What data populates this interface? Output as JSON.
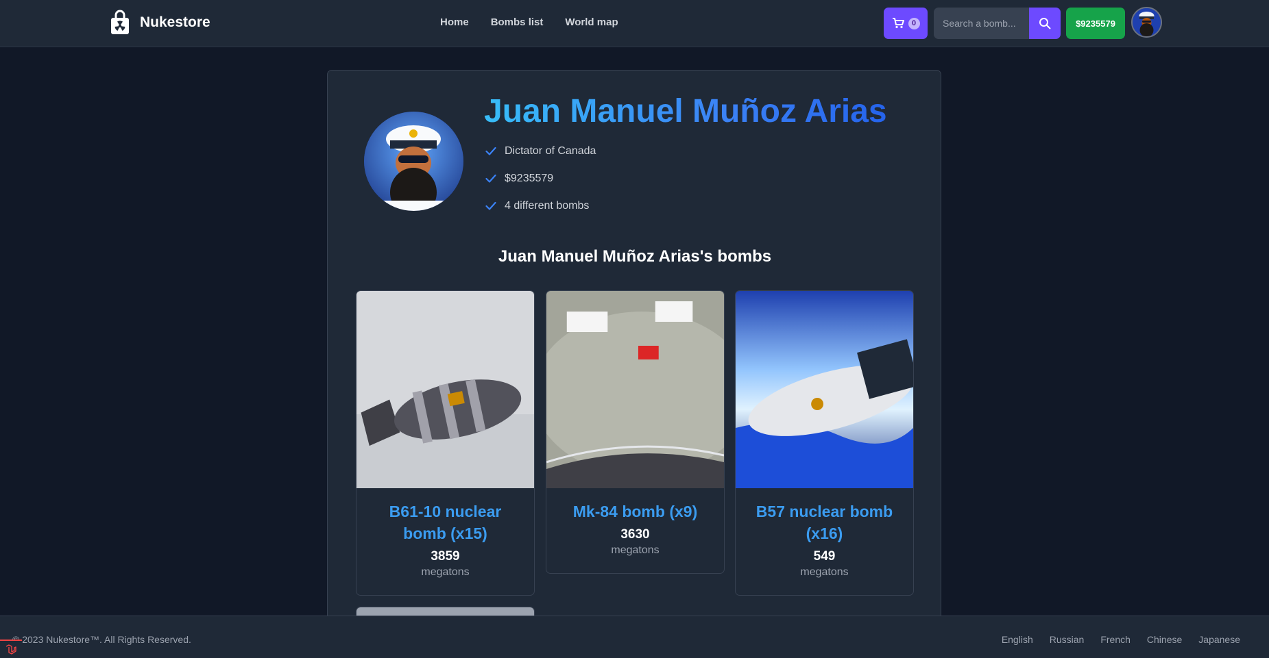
{
  "header": {
    "brand": "Nukestore",
    "brand_icon": "shopping-bag-radiation-icon",
    "nav": [
      {
        "label": "Home"
      },
      {
        "label": "Bombs list"
      },
      {
        "label": "World map"
      }
    ],
    "cart": {
      "icon": "cart-icon",
      "count": "0"
    },
    "search": {
      "placeholder": "Search a bomb...",
      "icon": "search-icon"
    },
    "balance": "$9235579",
    "accent_color": "#6d4aff",
    "balance_color": "#16a34a"
  },
  "profile": {
    "name": "Juan Manuel Muñoz Arias",
    "facts": [
      {
        "icon": "check-icon",
        "text": "Dictator of Canada"
      },
      {
        "icon": "check-icon",
        "text": "$9235579"
      },
      {
        "icon": "check-icon",
        "text": "4 different bombs"
      }
    ],
    "bombs_title": "Juan Manuel Muñoz Arias's bombs",
    "bombs": [
      {
        "title": "B61-10 nuclear bomb (x15)",
        "power": "3859",
        "unit": "megatons"
      },
      {
        "title": "Mk-84 bomb (x9)",
        "power": "3630",
        "unit": "megatons"
      },
      {
        "title": "B57 nuclear bomb (x16)",
        "power": "549",
        "unit": "megatons"
      }
    ]
  },
  "footer": {
    "copyright": "© 2023 Nukestore™. All Rights Reserved.",
    "languages": [
      "English",
      "Russian",
      "French",
      "Chinese",
      "Japanese"
    ]
  }
}
